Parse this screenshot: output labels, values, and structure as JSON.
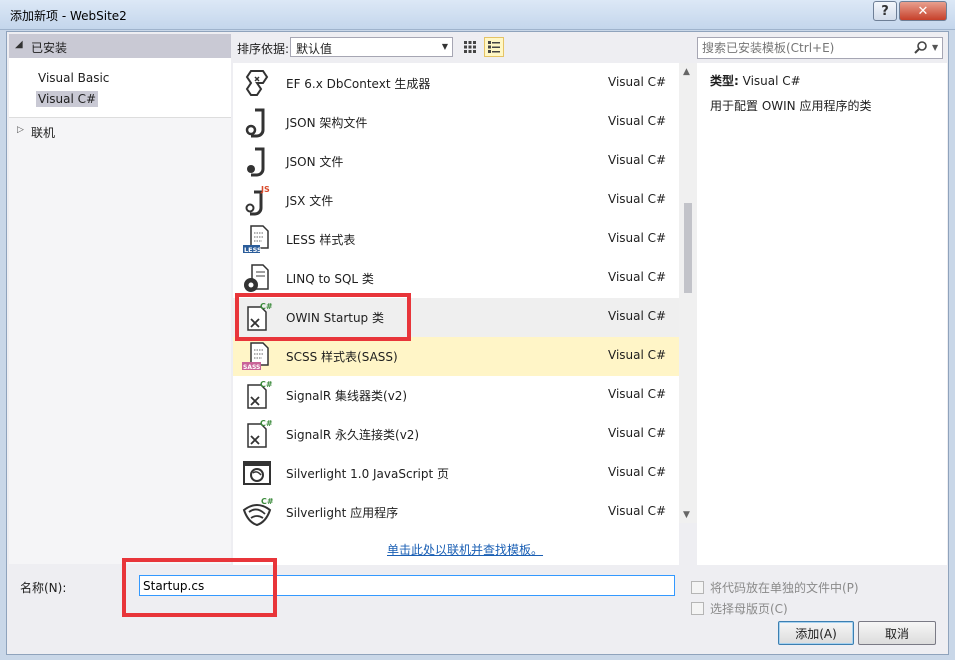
{
  "window": {
    "title": "添加新项 - WebSite2",
    "help": "?",
    "close": "✕"
  },
  "categories": {
    "installed": "已安装",
    "items": [
      "Visual Basic",
      "Visual C#"
    ],
    "online": "联机"
  },
  "toolbar": {
    "sort_label": "排序依据:",
    "sort_value": "默认值"
  },
  "search": {
    "placeholder": "搜索已安装模板(Ctrl+E)"
  },
  "templates": [
    {
      "name": "EF 6.x DbContext 生成器",
      "lang": "Visual C#",
      "icon": "ef-generator-icon"
    },
    {
      "name": "JSON 架构文件",
      "lang": "Visual C#",
      "icon": "json-schema-icon"
    },
    {
      "name": "JSON 文件",
      "lang": "Visual C#",
      "icon": "json-file-icon"
    },
    {
      "name": "JSX 文件",
      "lang": "Visual C#",
      "icon": "jsx-file-icon"
    },
    {
      "name": "LESS 样式表",
      "lang": "Visual C#",
      "icon": "less-stylesheet-icon"
    },
    {
      "name": "LINQ to SQL 类",
      "lang": "Visual C#",
      "icon": "linq-sql-icon"
    },
    {
      "name": "OWIN Startup 类",
      "lang": "Visual C#",
      "icon": "owin-startup-icon"
    },
    {
      "name": "SCSS 样式表(SASS)",
      "lang": "Visual C#",
      "icon": "scss-stylesheet-icon"
    },
    {
      "name": "SignalR 集线器类(v2)",
      "lang": "Visual C#",
      "icon": "signalr-hub-icon"
    },
    {
      "name": "SignalR 永久连接类(v2)",
      "lang": "Visual C#",
      "icon": "signalr-connection-icon"
    },
    {
      "name": "Silverlight 1.0 JavaScript 页",
      "lang": "Visual C#",
      "icon": "silverlight-js-icon"
    },
    {
      "name": "Silverlight 应用程序",
      "lang": "Visual C#",
      "icon": "silverlight-app-icon"
    }
  ],
  "online_link": "单击此处以联机并查找模板。",
  "description": {
    "type_label": "类型:",
    "type_value": "Visual C#",
    "text": "用于配置 OWIN 应用程序的类"
  },
  "name_label": "名称(N):",
  "name_value": "Startup.cs",
  "options": {
    "separate_file": "将代码放在单独的文件中(P)",
    "master_page": "选择母版页(C)"
  },
  "buttons": {
    "add": "添加(A)",
    "cancel": "取消"
  },
  "colors": {
    "accent": "#1a5fb4",
    "selection": "#fff5c7",
    "annotation": "#e8353a"
  }
}
